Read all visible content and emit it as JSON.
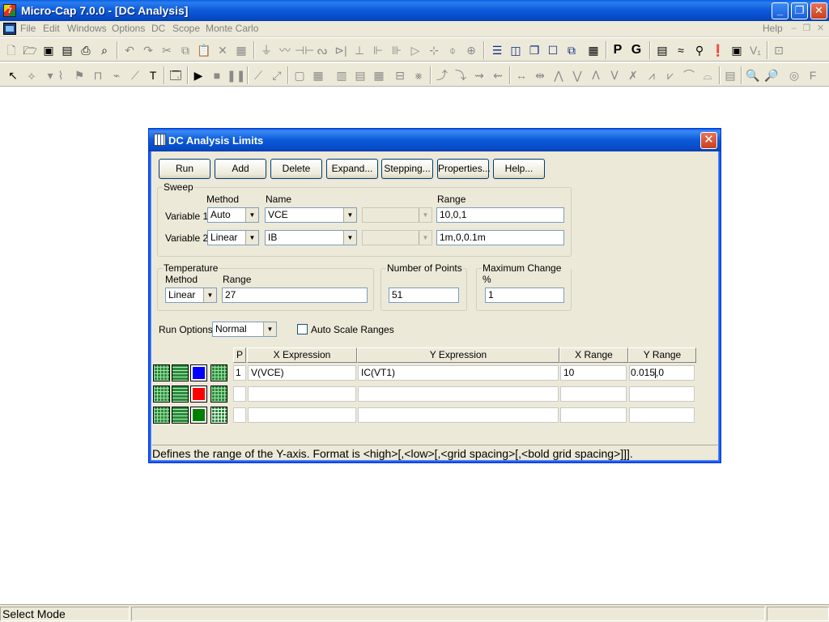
{
  "window": {
    "title": "Micro-Cap 7.0.0 - [DC Analysis]",
    "controls": {
      "minimize": "_",
      "restore": "❐",
      "close": "✕"
    }
  },
  "menubar": {
    "items": [
      "File",
      "Edit",
      "Windows",
      "Options",
      "DC",
      "Scope",
      "Monte Carlo"
    ],
    "help": "Help",
    "mdi_controls": [
      "–",
      "❐",
      "✕"
    ]
  },
  "toolbar1": {
    "groups": [
      [
        "new-icon",
        "open-icon",
        "save-icon",
        "save-all-icon",
        "print-icon",
        "print-preview-icon"
      ],
      [
        "undo-icon",
        "redo-icon",
        "cut-icon",
        "copy-icon",
        "paste-icon",
        "delete-icon",
        "select-all-icon"
      ],
      [
        "ground-icon",
        "resistor-icon",
        "capacitor-icon",
        "inductor-icon",
        "diode-icon",
        "battery-icon",
        "npn-icon",
        "nmos-icon",
        "opamp-icon",
        "wire-icon",
        "source-icon",
        "current-source-icon"
      ],
      [
        "tile-horizontal-icon",
        "tile-vertical-icon",
        "cascade-icon",
        "window-icon",
        "overlap-icon",
        "calculator-icon"
      ],
      [
        "P",
        "G"
      ],
      [
        "component-list-icon",
        "waveform-icon",
        "probe-icon",
        "info-icon",
        "display-icon",
        "text-icon",
        "zoom-fit-icon"
      ]
    ]
  },
  "toolbar2": {
    "groups": [
      [
        "select-mode-icon",
        "component-mode-icon",
        "wire-mode-icon",
        "bus-icon",
        "flag-icon",
        "pin-icon",
        "text-mode-icon"
      ],
      [
        "properties-icon"
      ],
      [
        "run-icon",
        "stop-icon",
        "pause-icon"
      ],
      [
        "line-icon",
        "diagonal-icon"
      ],
      [
        "grid-icon",
        "table-icon",
        "columns-icon",
        "rows-icon",
        "split-icon",
        "tracker-icon",
        "cursor-icon"
      ],
      [
        "peak-icon",
        "valley-icon",
        "high-icon",
        "low-icon",
        "inflection-icon",
        "slope-icon",
        "global-high-icon",
        "global-low-icon",
        "top-icon",
        "bottom-icon",
        "mark-icon",
        "label-icon"
      ],
      [
        "axis-icon",
        "zoom-in-icon",
        "zoom-out-icon",
        "scale-icon",
        "F"
      ]
    ]
  },
  "statusbar": {
    "mode": "Select Mode"
  },
  "dialog": {
    "title": "DC Analysis Limits",
    "close": "✕",
    "buttons": [
      "Run",
      "Add",
      "Delete",
      "Expand...",
      "Stepping...",
      "Properties...",
      "Help..."
    ],
    "sweep": {
      "legend": "Sweep",
      "col_method": "Method",
      "col_name": "Name",
      "col_range": "Range",
      "rows": [
        {
          "label": "Variable 1",
          "method": "Auto",
          "name": "VCE",
          "range": "10,0,1"
        },
        {
          "label": "Variable 2",
          "method": "Linear",
          "name": "IB",
          "range": "1m,0,0.1m"
        }
      ]
    },
    "temperature": {
      "legend": "Temperature",
      "method_label": "Method",
      "range_label": "Range",
      "method": "Linear",
      "range": "27"
    },
    "points": {
      "legend": "Number of Points",
      "value": "51"
    },
    "maxchange": {
      "legend": "Maximum Change %",
      "value": "1"
    },
    "run_options": {
      "label": "Run Options",
      "value": "Normal"
    },
    "auto_scale": {
      "label": "Auto Scale Ranges",
      "checked": false
    },
    "table": {
      "headers": {
        "p": "P",
        "x_expr": "X Expression",
        "y_expr": "Y Expression",
        "x_range": "X Range",
        "y_range": "Y Range"
      },
      "rows": [
        {
          "p": "1",
          "x_expr": "V(VCE)",
          "y_expr": "IC(VT1)",
          "x_range": "10",
          "y_range_a": "0.015",
          "y_range_b": ",0",
          "color": "#0000ff"
        },
        {
          "p": "",
          "x_expr": "",
          "y_expr": "",
          "x_range": "",
          "y_range_a": "",
          "y_range_b": "",
          "color": "#ff0000"
        },
        {
          "p": "",
          "x_expr": "",
          "y_expr": "",
          "x_range": "",
          "y_range_a": "",
          "y_range_b": "",
          "color": "#008000"
        }
      ]
    },
    "status_text": "Defines the range of the Y-axis. Format is <high>[,<low>[,<grid spacing>[,<bold grid spacing>]]]."
  }
}
